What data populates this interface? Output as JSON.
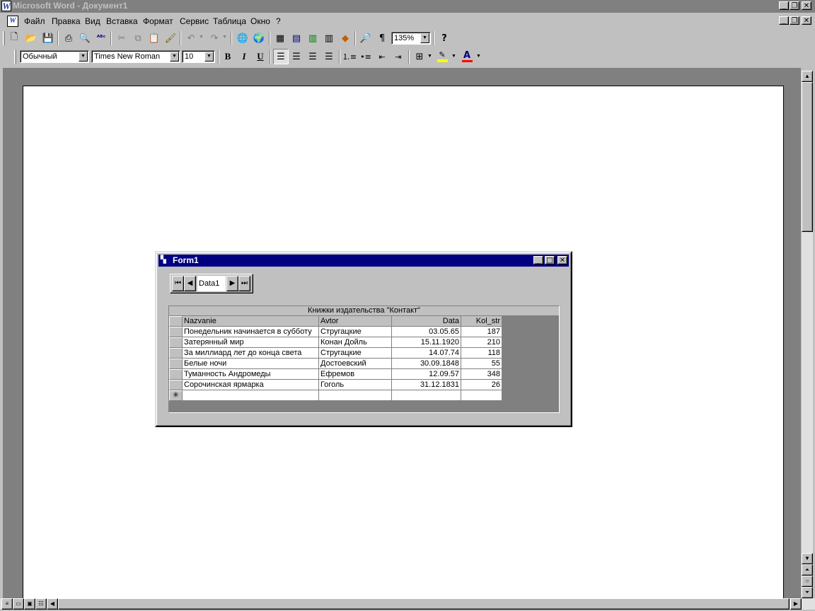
{
  "app": {
    "title": "Microsoft Word - Документ1",
    "logo_letter": "W"
  },
  "menu": {
    "items": [
      "Файл",
      "Правка",
      "Вид",
      "Вставка",
      "Формат",
      "Сервис",
      "Таблица",
      "Окно",
      "?"
    ]
  },
  "toolbar_standard": {
    "zoom": "135%"
  },
  "toolbar_format": {
    "style": "Обычный",
    "font": "Times New Roman",
    "size": "10",
    "bold": "B",
    "italic": "I",
    "underline": "U"
  },
  "colors": {
    "highlight": "#ffff00",
    "font_color": "#ff0000",
    "title_active": "#000080",
    "title_inactive": "#808080"
  },
  "form": {
    "title": "Form1",
    "data_caption": "Data1",
    "grid_caption": "Книжки издательства \"Контакт\"",
    "columns": [
      "Nazvanie",
      "Avtor",
      "Data",
      "Kol_str"
    ],
    "rows": [
      [
        "Понедельник начинается в субботу",
        "Стругацкие",
        "03.05.65",
        "187"
      ],
      [
        "Затерянный мир",
        "Конан Дойль",
        "15.11.1920",
        "210"
      ],
      [
        "За миллиард лет до конца света",
        "Стругацкие",
        "14.07.74",
        "118"
      ],
      [
        "Белые ночи",
        "Достоевский",
        "30.09.1848",
        "55"
      ],
      [
        "Туманность Андромеды",
        "Ефремов",
        "12.09.57",
        "348"
      ],
      [
        "Сорочинская ярмарка",
        "Гоголь",
        "31.12.1831",
        "26"
      ]
    ],
    "new_row_marker": "✳"
  }
}
